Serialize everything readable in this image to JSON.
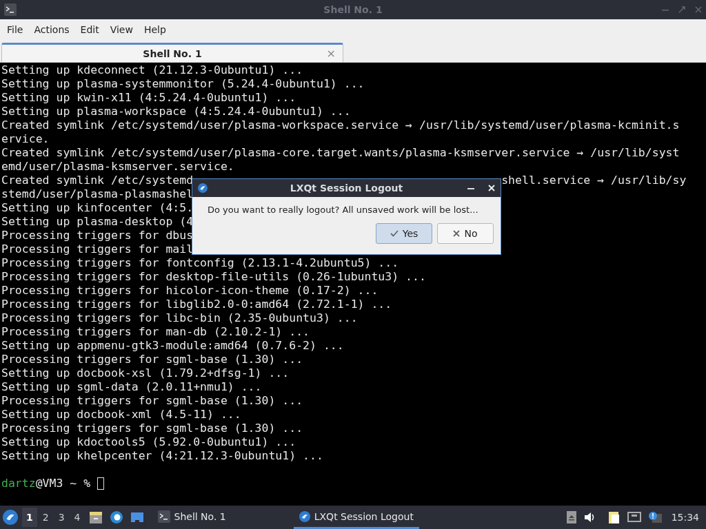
{
  "window": {
    "title": "Shell No. 1"
  },
  "menu": [
    "File",
    "Actions",
    "Edit",
    "View",
    "Help"
  ],
  "tabs": [
    {
      "label": "Shell No. 1",
      "selected": true,
      "close": "×"
    }
  ],
  "terminal": {
    "lines": [
      {
        "text": "Setting up kdeconnect (21.12.3-0ubuntu1) ..."
      },
      {
        "text": "Setting up plasma-systemmonitor (5.24.4-0ubuntu1) ..."
      },
      {
        "text": "Setting up kwin-x11 (4:5.24.4-0ubuntu1) ..."
      },
      {
        "text": "Setting up plasma-workspace (4:5.24.4-0ubuntu1) ..."
      },
      {
        "text": "Created symlink /etc/systemd/user/plasma-workspace.service → /usr/lib/systemd/user/plasma-kcminit.s"
      },
      {
        "text": "ervice."
      },
      {
        "text": "Created symlink /etc/systemd/user/plasma-core.target.wants/plasma-ksmserver.service → /usr/lib/syst"
      },
      {
        "text": "emd/user/plasma-ksmserver.service."
      },
      {
        "text": "Created symlink /etc/systemd",
        "tail": "shell.service → /usr/lib/sy"
      },
      {
        "text": "stemd/user/plasma-plasmashel"
      },
      {
        "text": "Setting up kinfocenter (4:5."
      },
      {
        "text": "Setting up plasma-desktop (4"
      },
      {
        "text": "Processing triggers for dbus"
      },
      {
        "text": "Processing triggers for mail"
      },
      {
        "text": "Processing triggers for fontconfig (2.13.1-4.2ubuntu5) ..."
      },
      {
        "text": "Processing triggers for desktop-file-utils (0.26-1ubuntu3) ..."
      },
      {
        "text": "Processing triggers for hicolor-icon-theme (0.17-2) ..."
      },
      {
        "text": "Processing triggers for libglib2.0-0:amd64 (2.72.1-1) ..."
      },
      {
        "text": "Processing triggers for libc-bin (2.35-0ubuntu3) ..."
      },
      {
        "text": "Processing triggers for man-db (2.10.2-1) ..."
      },
      {
        "text": "Setting up appmenu-gtk3-module:amd64 (0.7.6-2) ..."
      },
      {
        "text": "Processing triggers for sgml-base (1.30) ..."
      },
      {
        "text": "Setting up docbook-xsl (1.79.2+dfsg-1) ..."
      },
      {
        "text": "Setting up sgml-data (2.0.11+nmu1) ..."
      },
      {
        "text": "Processing triggers for sgml-base (1.30) ..."
      },
      {
        "text": "Setting up docbook-xml (4.5-11) ..."
      },
      {
        "text": "Processing triggers for sgml-base (1.30) ..."
      },
      {
        "text": "Setting up kdoctools5 (5.92.0-0ubuntu1) ..."
      },
      {
        "text": "Setting up khelpcenter (4:21.12.3-0ubuntu1) ..."
      }
    ],
    "prompt": {
      "user": "dartz",
      "rest": "@VM3 ~ %"
    }
  },
  "dialog": {
    "title": "LXQt Session Logout",
    "message": "Do you want to really logout? All unsaved work will be lost...",
    "buttons": [
      {
        "label": "Yes",
        "kind": "yes",
        "selected": true
      },
      {
        "label": "No",
        "kind": "no",
        "selected": false
      }
    ]
  },
  "taskbar": {
    "desktops": [
      {
        "label": "1",
        "selected": true
      },
      {
        "label": "2",
        "selected": false
      },
      {
        "label": "3",
        "selected": false
      },
      {
        "label": "4",
        "selected": false
      }
    ],
    "tasks": [
      {
        "label": "Shell No. 1",
        "kind": "terminal",
        "selected": false
      },
      {
        "label": "LXQt Session Logout",
        "kind": "logout",
        "selected": true
      }
    ],
    "clock": "15:34"
  }
}
